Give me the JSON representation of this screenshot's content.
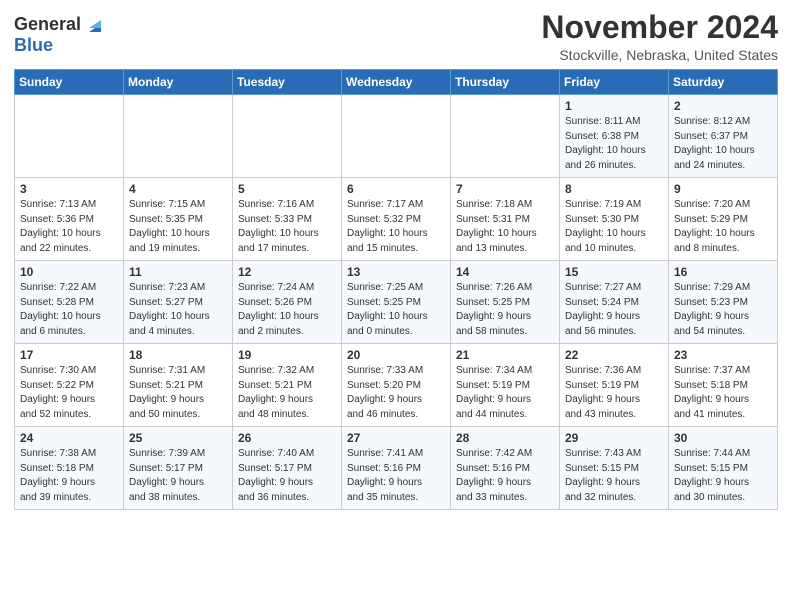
{
  "header": {
    "logo_general": "General",
    "logo_blue": "Blue",
    "month_title": "November 2024",
    "location": "Stockville, Nebraska, United States"
  },
  "days_of_week": [
    "Sunday",
    "Monday",
    "Tuesday",
    "Wednesday",
    "Thursday",
    "Friday",
    "Saturday"
  ],
  "weeks": [
    [
      {
        "day": "",
        "info": ""
      },
      {
        "day": "",
        "info": ""
      },
      {
        "day": "",
        "info": ""
      },
      {
        "day": "",
        "info": ""
      },
      {
        "day": "",
        "info": ""
      },
      {
        "day": "1",
        "info": "Sunrise: 8:11 AM\nSunset: 6:38 PM\nDaylight: 10 hours\nand 26 minutes."
      },
      {
        "day": "2",
        "info": "Sunrise: 8:12 AM\nSunset: 6:37 PM\nDaylight: 10 hours\nand 24 minutes."
      }
    ],
    [
      {
        "day": "3",
        "info": "Sunrise: 7:13 AM\nSunset: 5:36 PM\nDaylight: 10 hours\nand 22 minutes."
      },
      {
        "day": "4",
        "info": "Sunrise: 7:15 AM\nSunset: 5:35 PM\nDaylight: 10 hours\nand 19 minutes."
      },
      {
        "day": "5",
        "info": "Sunrise: 7:16 AM\nSunset: 5:33 PM\nDaylight: 10 hours\nand 17 minutes."
      },
      {
        "day": "6",
        "info": "Sunrise: 7:17 AM\nSunset: 5:32 PM\nDaylight: 10 hours\nand 15 minutes."
      },
      {
        "day": "7",
        "info": "Sunrise: 7:18 AM\nSunset: 5:31 PM\nDaylight: 10 hours\nand 13 minutes."
      },
      {
        "day": "8",
        "info": "Sunrise: 7:19 AM\nSunset: 5:30 PM\nDaylight: 10 hours\nand 10 minutes."
      },
      {
        "day": "9",
        "info": "Sunrise: 7:20 AM\nSunset: 5:29 PM\nDaylight: 10 hours\nand 8 minutes."
      }
    ],
    [
      {
        "day": "10",
        "info": "Sunrise: 7:22 AM\nSunset: 5:28 PM\nDaylight: 10 hours\nand 6 minutes."
      },
      {
        "day": "11",
        "info": "Sunrise: 7:23 AM\nSunset: 5:27 PM\nDaylight: 10 hours\nand 4 minutes."
      },
      {
        "day": "12",
        "info": "Sunrise: 7:24 AM\nSunset: 5:26 PM\nDaylight: 10 hours\nand 2 minutes."
      },
      {
        "day": "13",
        "info": "Sunrise: 7:25 AM\nSunset: 5:25 PM\nDaylight: 10 hours\nand 0 minutes."
      },
      {
        "day": "14",
        "info": "Sunrise: 7:26 AM\nSunset: 5:25 PM\nDaylight: 9 hours\nand 58 minutes."
      },
      {
        "day": "15",
        "info": "Sunrise: 7:27 AM\nSunset: 5:24 PM\nDaylight: 9 hours\nand 56 minutes."
      },
      {
        "day": "16",
        "info": "Sunrise: 7:29 AM\nSunset: 5:23 PM\nDaylight: 9 hours\nand 54 minutes."
      }
    ],
    [
      {
        "day": "17",
        "info": "Sunrise: 7:30 AM\nSunset: 5:22 PM\nDaylight: 9 hours\nand 52 minutes."
      },
      {
        "day": "18",
        "info": "Sunrise: 7:31 AM\nSunset: 5:21 PM\nDaylight: 9 hours\nand 50 minutes."
      },
      {
        "day": "19",
        "info": "Sunrise: 7:32 AM\nSunset: 5:21 PM\nDaylight: 9 hours\nand 48 minutes."
      },
      {
        "day": "20",
        "info": "Sunrise: 7:33 AM\nSunset: 5:20 PM\nDaylight: 9 hours\nand 46 minutes."
      },
      {
        "day": "21",
        "info": "Sunrise: 7:34 AM\nSunset: 5:19 PM\nDaylight: 9 hours\nand 44 minutes."
      },
      {
        "day": "22",
        "info": "Sunrise: 7:36 AM\nSunset: 5:19 PM\nDaylight: 9 hours\nand 43 minutes."
      },
      {
        "day": "23",
        "info": "Sunrise: 7:37 AM\nSunset: 5:18 PM\nDaylight: 9 hours\nand 41 minutes."
      }
    ],
    [
      {
        "day": "24",
        "info": "Sunrise: 7:38 AM\nSunset: 5:18 PM\nDaylight: 9 hours\nand 39 minutes."
      },
      {
        "day": "25",
        "info": "Sunrise: 7:39 AM\nSunset: 5:17 PM\nDaylight: 9 hours\nand 38 minutes."
      },
      {
        "day": "26",
        "info": "Sunrise: 7:40 AM\nSunset: 5:17 PM\nDaylight: 9 hours\nand 36 minutes."
      },
      {
        "day": "27",
        "info": "Sunrise: 7:41 AM\nSunset: 5:16 PM\nDaylight: 9 hours\nand 35 minutes."
      },
      {
        "day": "28",
        "info": "Sunrise: 7:42 AM\nSunset: 5:16 PM\nDaylight: 9 hours\nand 33 minutes."
      },
      {
        "day": "29",
        "info": "Sunrise: 7:43 AM\nSunset: 5:15 PM\nDaylight: 9 hours\nand 32 minutes."
      },
      {
        "day": "30",
        "info": "Sunrise: 7:44 AM\nSunset: 5:15 PM\nDaylight: 9 hours\nand 30 minutes."
      }
    ]
  ]
}
